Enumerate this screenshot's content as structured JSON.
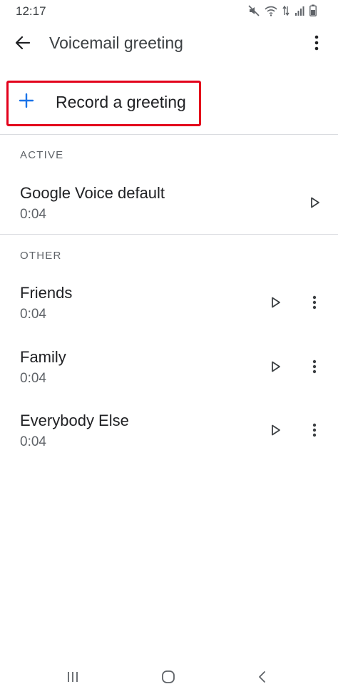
{
  "status_bar": {
    "time": "12:17",
    "icons": [
      "mute-icon",
      "wifi-icon",
      "data-transfer-icon",
      "signal-icon",
      "battery-icon"
    ]
  },
  "app_bar": {
    "title": "Voicemail greeting",
    "back_icon": "arrow-back-icon",
    "menu_icon": "more-vert-icon"
  },
  "record": {
    "label": "Record a greeting",
    "icon": "plus-icon",
    "accent": "#1a73e8",
    "highlight_color": "#e3001b"
  },
  "sections": [
    {
      "header": "ACTIVE",
      "items": [
        {
          "name": "Google Voice default",
          "duration": "0:04"
        }
      ]
    },
    {
      "header": "OTHER",
      "items": [
        {
          "name": "Friends",
          "duration": "0:04"
        },
        {
          "name": "Family",
          "duration": "0:04"
        },
        {
          "name": "Everybody Else",
          "duration": "0:04"
        }
      ]
    }
  ],
  "nav_bar": {
    "icons": [
      "recent-apps-icon",
      "home-icon",
      "back-icon"
    ]
  }
}
